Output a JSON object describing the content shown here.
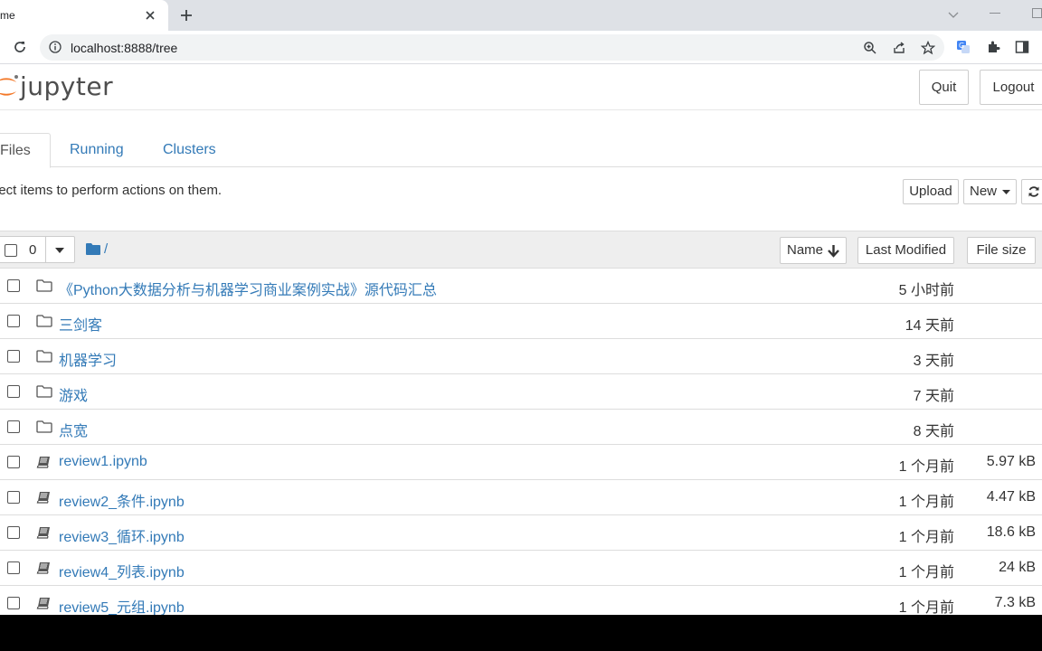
{
  "browser": {
    "tab_title": "me",
    "url": "localhost:8888/tree"
  },
  "header": {
    "logo_text": "jupyter",
    "quit_label": "Quit",
    "logout_label": "Logout"
  },
  "tabs": [
    {
      "label": "Files",
      "active": true
    },
    {
      "label": "Running",
      "active": false
    },
    {
      "label": "Clusters",
      "active": false
    }
  ],
  "actions": {
    "instructions": "lect items to perform actions on them.",
    "upload_label": "Upload",
    "new_label": "New"
  },
  "list_header": {
    "selected_count": "0",
    "breadcrumb": "/",
    "name_label": "Name",
    "modified_label": "Last Modified",
    "size_label": "File size"
  },
  "items": [
    {
      "type": "folder",
      "name": "《Python大数据分析与机器学习商业案例实战》源代码汇总",
      "modified": "5 小时前",
      "size": ""
    },
    {
      "type": "folder",
      "name": "三剑客",
      "modified": "14 天前",
      "size": ""
    },
    {
      "type": "folder",
      "name": "机器学习",
      "modified": "3 天前",
      "size": ""
    },
    {
      "type": "folder",
      "name": "游戏",
      "modified": "7 天前",
      "size": ""
    },
    {
      "type": "folder",
      "name": "点宽",
      "modified": "8 天前",
      "size": ""
    },
    {
      "type": "notebook",
      "name": "review1.ipynb",
      "modified": "1 个月前",
      "size": "5.97 kB"
    },
    {
      "type": "notebook",
      "name": "review2_条件.ipynb",
      "modified": "1 个月前",
      "size": "4.47 kB"
    },
    {
      "type": "notebook",
      "name": "review3_循环.ipynb",
      "modified": "1 个月前",
      "size": "18.6 kB"
    },
    {
      "type": "notebook",
      "name": "review4_列表.ipynb",
      "modified": "1 个月前",
      "size": "24 kB"
    },
    {
      "type": "notebook",
      "name": "review5_元组.ipynb",
      "modified": "1 个月前",
      "size": "7.3 kB"
    }
  ],
  "colors": {
    "link": "#337ab7",
    "logo_orange": "#f37726",
    "header_bg": "#eeeeee"
  }
}
